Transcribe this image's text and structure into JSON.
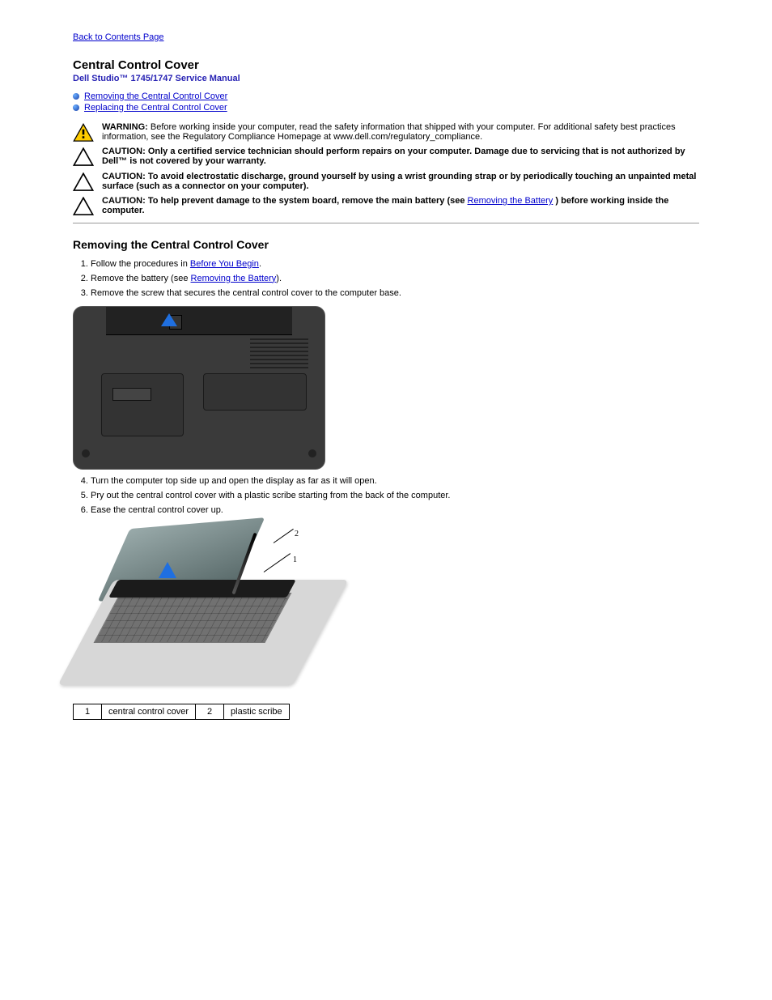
{
  "back_link": "Back to Contents Page",
  "page_title": "Central Control Cover",
  "doc_title": "Dell Studio™ 1745/1747 Service Manual",
  "toc": [
    {
      "label": "Removing the Central Control Cover"
    },
    {
      "label": "Replacing the Central Control Cover"
    }
  ],
  "warnings": {
    "w1_label": "WARNING:",
    "w1_text": "Before working inside your computer, read the safety information that shipped with your computer. For additional safety best practices information, see the Regulatory Compliance Homepage at www.dell.com/regulatory_compliance.",
    "c1_label": "CAUTION:",
    "c1_text_a": "Only a certified service technician should perform repairs on your computer. Damage due to servicing that is not authorized by Dell™",
    "c1_text_b": "is not covered by your warranty.",
    "c2_label": "CAUTION:",
    "c2_text": "To avoid electrostatic discharge, ground yourself by using a wrist grounding strap or by periodically touching an unpainted metal surface (such as a connector on your computer).",
    "c3_label": "CAUTION:",
    "c3_text_a": "To help prevent damage to the system board, remove the main battery (see ",
    "c3_link": "Removing the Battery",
    "c3_text_b": ") before working inside the computer."
  },
  "section1_title": "Removing the Central Control Cover",
  "steps1": [
    {
      "pre": "Follow the procedures in ",
      "link": "Before You Begin",
      "post": "."
    },
    {
      "pre": "Remove the battery (see ",
      "link": "Removing the Battery",
      "post": ")."
    },
    {
      "pre": "Remove the screw that secures the central control cover to the computer base.",
      "link": "",
      "post": ""
    }
  ],
  "steps2": [
    "Turn the computer top side up and open the display as far as it will open.",
    "Pry out the central control cover with a plastic scribe starting from the back of the computer.",
    "Ease the central control cover up."
  ],
  "callout": {
    "c1_num": "1",
    "c1_label": "central control cover",
    "c2_num": "2",
    "c2_label": "plastic scribe"
  },
  "figure_labels": {
    "one": "1",
    "two": "2"
  }
}
